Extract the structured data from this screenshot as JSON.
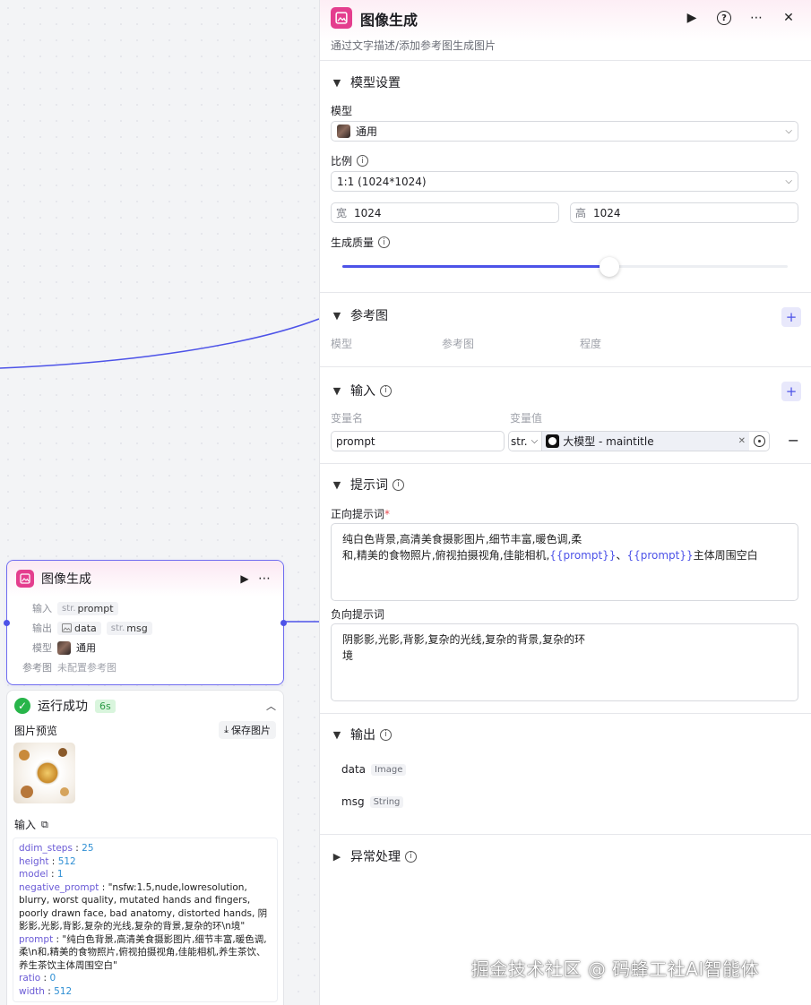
{
  "panel": {
    "title": "图像生成",
    "subtitle": "通过文字描述/添加参考图生成图片",
    "model_section": {
      "title": "模型设置",
      "model_label": "模型",
      "model_value": "通用",
      "ratio_label": "比例",
      "ratio_value": "1:1 (1024*1024)",
      "width_prefix": "宽",
      "width_value": "1024",
      "height_prefix": "高",
      "height_value": "1024",
      "quality_label": "生成质量",
      "quality_fraction": 0.6
    },
    "reference_section": {
      "title": "参考图",
      "columns": [
        "模型",
        "参考图",
        "程度"
      ]
    },
    "input_section": {
      "title": "输入",
      "col_name": "变量名",
      "col_value": "变量值",
      "var_name": "prompt",
      "var_type": "str.",
      "var_source": "大模型 - maintitle"
    },
    "prompt_section": {
      "title": "提示词",
      "positive_label": "正向提示词",
      "positive_required_mark": "*",
      "positive_line1": "纯白色背景,高清美食摄影图片,细节丰富,暖色调,柔",
      "positive_line2_a": "和,精美的食物照片,俯视拍摄视角,佳能相机,",
      "positive_var1": "{{prompt}}",
      "positive_sep": "、",
      "positive_var2": "{{prompt}}",
      "positive_line2_b": "主体周围空白",
      "negative_label": "负向提示词",
      "negative_line1": "阴影影,光影,背影,复杂的光线,复杂的背景,复杂的环",
      "negative_line2": "境"
    },
    "output_section": {
      "title": "输出",
      "items": [
        {
          "name": "data",
          "type": "Image"
        },
        {
          "name": "msg",
          "type": "String"
        }
      ]
    },
    "error_section": {
      "title": "异常处理"
    }
  },
  "node": {
    "title": "图像生成",
    "input_label": "输入",
    "input_type": "str.",
    "input_value": "prompt",
    "output_label": "输出",
    "output1_value": "data",
    "output2_type": "str.",
    "output2_value": "msg",
    "model_label": "模型",
    "model_value": "通用",
    "ref_label": "参考图",
    "ref_value": "未配置参考图"
  },
  "run": {
    "status": "运行成功",
    "duration": "6s",
    "preview_label": "图片预览",
    "save_label": "保存图片",
    "input_label": "输入",
    "params": [
      {
        "key": "ddim_steps",
        "value": "25",
        "kind": "num"
      },
      {
        "key": "height",
        "value": "512",
        "kind": "num"
      },
      {
        "key": "model",
        "value": "1",
        "kind": "num"
      },
      {
        "key": "negative_prompt",
        "value": "\"nsfw:1.5,nude,lowresolution, blurry, worst quality, mutated hands and fingers, poorly drawn face, bad anatomy, distorted hands, 阴影影,光影,背影,复杂的光线,复杂的背景,复杂的环\\n境\"",
        "kind": "str"
      },
      {
        "key": "prompt",
        "value": "\"纯白色背景,高清美食摄影图片,细节丰富,暖色调,柔\\n和,精美的食物照片,俯视拍摄视角,佳能相机,养生茶饮、养生茶饮主体周围空白\"",
        "kind": "str"
      },
      {
        "key": "ratio",
        "value": "0",
        "kind": "num"
      },
      {
        "key": "width",
        "value": "512",
        "kind": "num"
      }
    ]
  },
  "watermark": "掘金技术社区 @ 码蜂工社AI智能体",
  "colors": {
    "accent": "#4d53e8",
    "success": "#28b54a",
    "brand_icon": "#e43e8e"
  }
}
